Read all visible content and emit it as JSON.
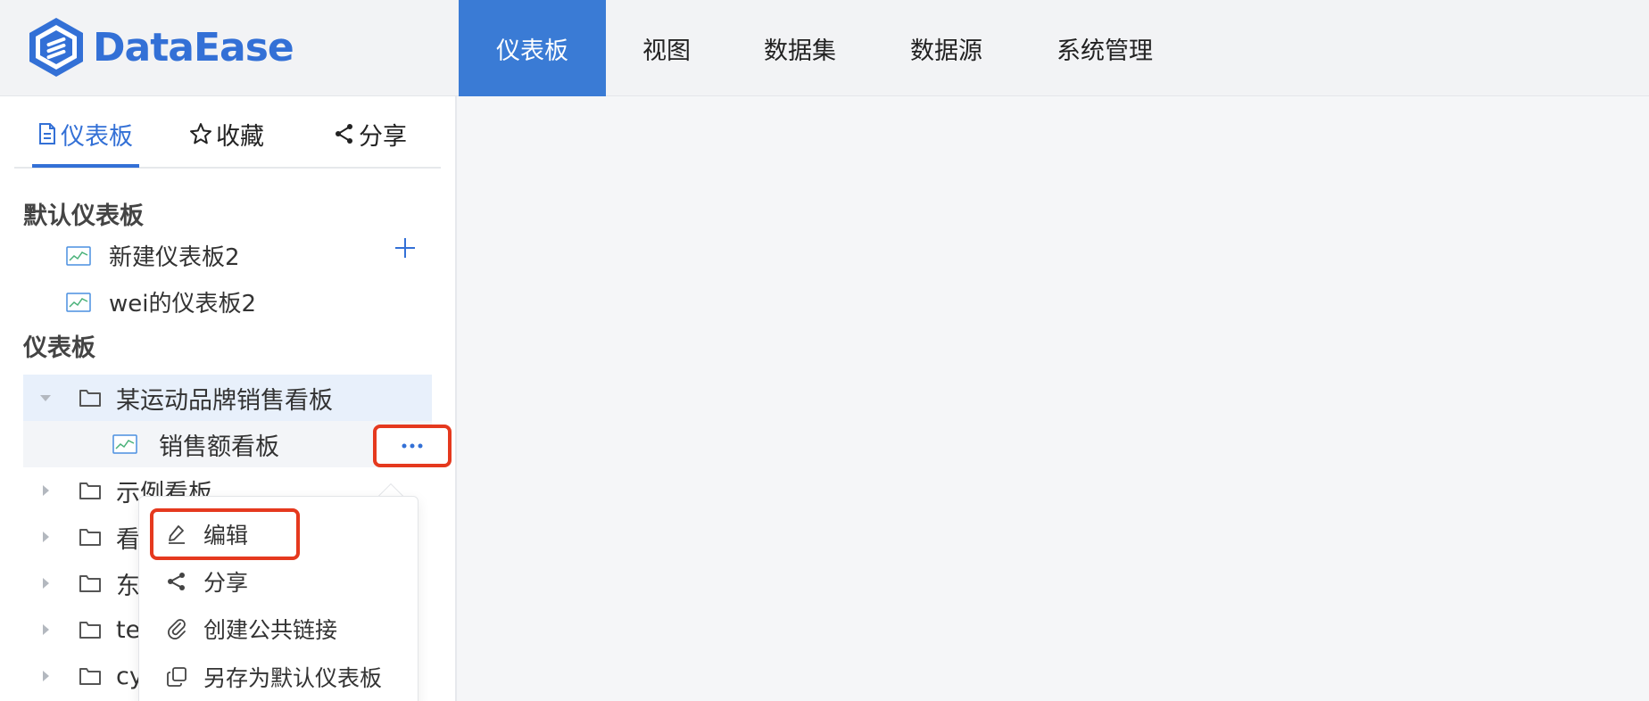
{
  "app": {
    "brand": "DataEase",
    "accent": "#3370d6",
    "highlight": "#e5391e"
  },
  "nav": {
    "items": [
      {
        "label": "仪表板",
        "active": true
      },
      {
        "label": "视图",
        "active": false
      },
      {
        "label": "数据集",
        "active": false
      },
      {
        "label": "数据源",
        "active": false
      },
      {
        "label": "系统管理",
        "active": false
      }
    ]
  },
  "sidebar": {
    "tabs": [
      {
        "label": "仪表板",
        "icon": "document-icon",
        "active": true
      },
      {
        "label": "收藏",
        "icon": "star-icon",
        "active": false
      },
      {
        "label": "分享",
        "icon": "share-icon",
        "active": false
      }
    ],
    "default_section": {
      "title": "默认仪表板",
      "items": [
        "新建仪表板2",
        "wei的仪表板2"
      ]
    },
    "dashboard_section": {
      "title": "仪表板",
      "tree": [
        {
          "label": "某运动品牌销售看板",
          "expanded": true,
          "children": [
            {
              "label": "销售额看板"
            }
          ]
        },
        {
          "label": "示例看板",
          "expanded": false
        },
        {
          "label": "看",
          "expanded": false
        },
        {
          "label": "东",
          "expanded": false
        },
        {
          "label": "te",
          "expanded": false
        },
        {
          "label": "cy",
          "expanded": false
        }
      ]
    }
  },
  "context_menu": {
    "items": [
      {
        "label": "编辑",
        "icon": "edit-icon"
      },
      {
        "label": "分享",
        "icon": "share-icon"
      },
      {
        "label": "创建公共链接",
        "icon": "paperclip-icon"
      },
      {
        "label": "另存为默认仪表板",
        "icon": "copy-icon"
      }
    ]
  }
}
